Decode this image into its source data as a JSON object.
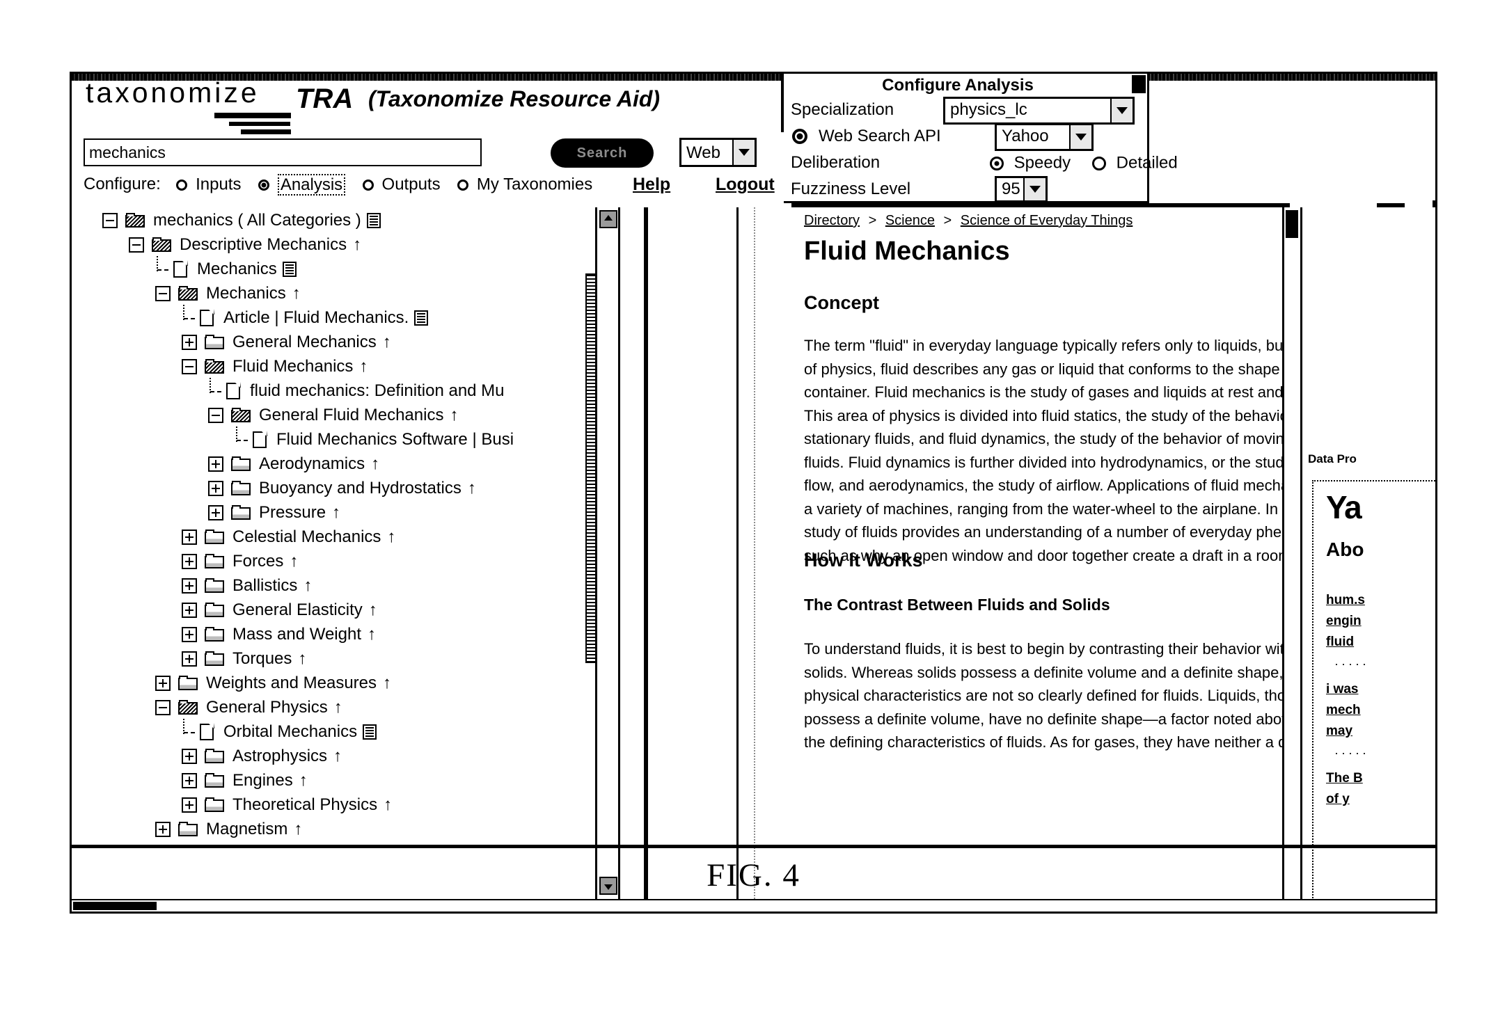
{
  "figure": {
    "caption": "FIG. 4"
  },
  "brand": {
    "logo": "taxonomize",
    "tra": "TRA",
    "expansion": "(Taxonomize Resource Aid)"
  },
  "search": {
    "value": "mechanics",
    "placeholder": "",
    "button_label": "Search",
    "scope_value": "Web"
  },
  "configure": {
    "label": "Configure:",
    "options": [
      {
        "label": "Inputs",
        "selected": false
      },
      {
        "label": "Analysis",
        "selected": true
      },
      {
        "label": "Outputs",
        "selected": false
      },
      {
        "label": "My Taxonomies",
        "selected": false
      }
    ],
    "help_label": "Help",
    "logout_label": "Logout"
  },
  "config_panel": {
    "title": "Configure Analysis",
    "specialization_label": "Specialization",
    "specialization_value": "physics_lc",
    "web_search_api_label": "Web Search API",
    "web_search_api_value": "Yahoo",
    "deliberation_label": "Deliberation",
    "deliberation_speedy": "Speedy",
    "deliberation_detailed": "Detailed",
    "deliberation_selected": "Speedy",
    "fuzziness_label": "Fuzziness Level",
    "fuzziness_value": "95"
  },
  "tree": {
    "items": [
      {
        "label": "mechanics ( All Categories )",
        "depth": 0,
        "toggle": "minus",
        "icon": "folder-open-icon",
        "arrow": false,
        "page": true
      },
      {
        "label": "Descriptive Mechanics",
        "depth": 1,
        "toggle": "minus",
        "icon": "folder-open-icon",
        "arrow": true,
        "page": false
      },
      {
        "label": "Mechanics",
        "depth": 2,
        "toggle": "leaf",
        "icon": "document-icon",
        "arrow": false,
        "page": true
      },
      {
        "label": "Mechanics",
        "depth": 2,
        "toggle": "minus",
        "icon": "folder-open-icon",
        "arrow": true,
        "page": false
      },
      {
        "label": "Article | Fluid Mechanics.",
        "depth": 3,
        "toggle": "leaf",
        "icon": "document-icon",
        "arrow": false,
        "page": true
      },
      {
        "label": "General Mechanics",
        "depth": 3,
        "toggle": "plus",
        "icon": "folder-closed-icon",
        "arrow": true,
        "page": false
      },
      {
        "label": "Fluid Mechanics",
        "depth": 3,
        "toggle": "minus",
        "icon": "folder-open-icon",
        "arrow": true,
        "page": false
      },
      {
        "label": "fluid mechanics: Definition and Mu",
        "depth": 4,
        "toggle": "leaf",
        "icon": "document-icon",
        "arrow": false,
        "page": false
      },
      {
        "label": "General Fluid Mechanics",
        "depth": 4,
        "toggle": "minus",
        "icon": "folder-open-icon",
        "arrow": true,
        "page": false
      },
      {
        "label": "Fluid Mechanics Software | Busi",
        "depth": 5,
        "toggle": "leaf",
        "icon": "document-icon",
        "arrow": false,
        "page": false
      },
      {
        "label": "Aerodynamics",
        "depth": 4,
        "toggle": "plus",
        "icon": "folder-closed-icon",
        "arrow": true,
        "page": false
      },
      {
        "label": "Buoyancy and Hydrostatics",
        "depth": 4,
        "toggle": "plus",
        "icon": "folder-closed-icon",
        "arrow": true,
        "page": false
      },
      {
        "label": "Pressure",
        "depth": 4,
        "toggle": "plus",
        "icon": "folder-closed-icon",
        "arrow": true,
        "page": false
      },
      {
        "label": "Celestial Mechanics",
        "depth": 3,
        "toggle": "plus",
        "icon": "folder-closed-icon",
        "arrow": true,
        "page": false
      },
      {
        "label": "Forces",
        "depth": 3,
        "toggle": "plus",
        "icon": "folder-closed-icon",
        "arrow": true,
        "page": false
      },
      {
        "label": "Ballistics",
        "depth": 3,
        "toggle": "plus",
        "icon": "folder-closed-icon",
        "arrow": true,
        "page": false
      },
      {
        "label": "General Elasticity",
        "depth": 3,
        "toggle": "plus",
        "icon": "folder-closed-icon",
        "arrow": true,
        "page": false
      },
      {
        "label": "Mass and Weight",
        "depth": 3,
        "toggle": "plus",
        "icon": "folder-closed-icon",
        "arrow": true,
        "page": false
      },
      {
        "label": "Torques",
        "depth": 3,
        "toggle": "plus",
        "icon": "folder-closed-icon",
        "arrow": true,
        "page": false
      },
      {
        "label": "Weights and Measures",
        "depth": 2,
        "toggle": "plus",
        "icon": "folder-closed-icon",
        "arrow": true,
        "page": false
      },
      {
        "label": "General Physics",
        "depth": 2,
        "toggle": "minus",
        "icon": "folder-open-icon",
        "arrow": true,
        "page": false
      },
      {
        "label": "Orbital Mechanics",
        "depth": 3,
        "toggle": "leaf",
        "icon": "document-icon",
        "arrow": false,
        "page": true
      },
      {
        "label": "Astrophysics",
        "depth": 3,
        "toggle": "plus",
        "icon": "folder-closed-icon",
        "arrow": true,
        "page": false
      },
      {
        "label": "Engines",
        "depth": 3,
        "toggle": "plus",
        "icon": "folder-closed-icon",
        "arrow": true,
        "page": false
      },
      {
        "label": "Theoretical Physics",
        "depth": 3,
        "toggle": "plus",
        "icon": "folder-closed-icon",
        "arrow": true,
        "page": false
      },
      {
        "label": "Magnetism",
        "depth": 2,
        "toggle": "plus",
        "icon": "folder-closed-icon",
        "arrow": true,
        "page": false
      }
    ]
  },
  "content": {
    "breadcrumb": [
      "Directory",
      "Science",
      "Science of Everyday Things"
    ],
    "breadcrumb_separator": ">",
    "title": "Fluid Mechanics",
    "h2_concept": "Concept",
    "p_concept": "The term \"fluid\" in everyday language typically refers only to liquids, but in the realm of physics, fluid describes any gas or liquid that conforms to the shape of its container. Fluid mechanics is the study of gases and liquids at rest and in motion. This area of physics is divided into fluid statics, the study of the behavior of stationary fluids, and fluid dynamics, the study of the behavior of moving, or flowing, fluids. Fluid dynamics is further divided into hydrodynamics, or the study of water flow, and aerodynamics, the study of airflow. Applications of fluid mechanics include a variety of machines, ranging from the water-wheel to the airplane. In addition, the study of fluids provides an understanding of a number of everyday phenomena, such as why an open window and door together create a draft in a room.",
    "h2_howitworks": "How It Works",
    "h3_contrast": "The Contrast Between Fluids and Solids",
    "p_contrast": "To understand fluids, it is best to begin by contrasting their behavior with that of solids. Whereas solids possess a definite volume and a definite shape, these physical characteristics are not so clearly defined for fluids. Liquids, though they possess a definite volume, have no definite shape—a factor noted above as one of the defining characteristics of fluids. As for gases, they have neither a definite"
  },
  "right_sidebar": {
    "data_provider_label": "Data Pro",
    "logo": "Ya",
    "about_label": "Abo",
    "links": [
      "hum.s",
      "engin",
      "fluid",
      "i was",
      "mech",
      "may",
      "The B",
      "of y"
    ],
    "dots": "·····"
  }
}
